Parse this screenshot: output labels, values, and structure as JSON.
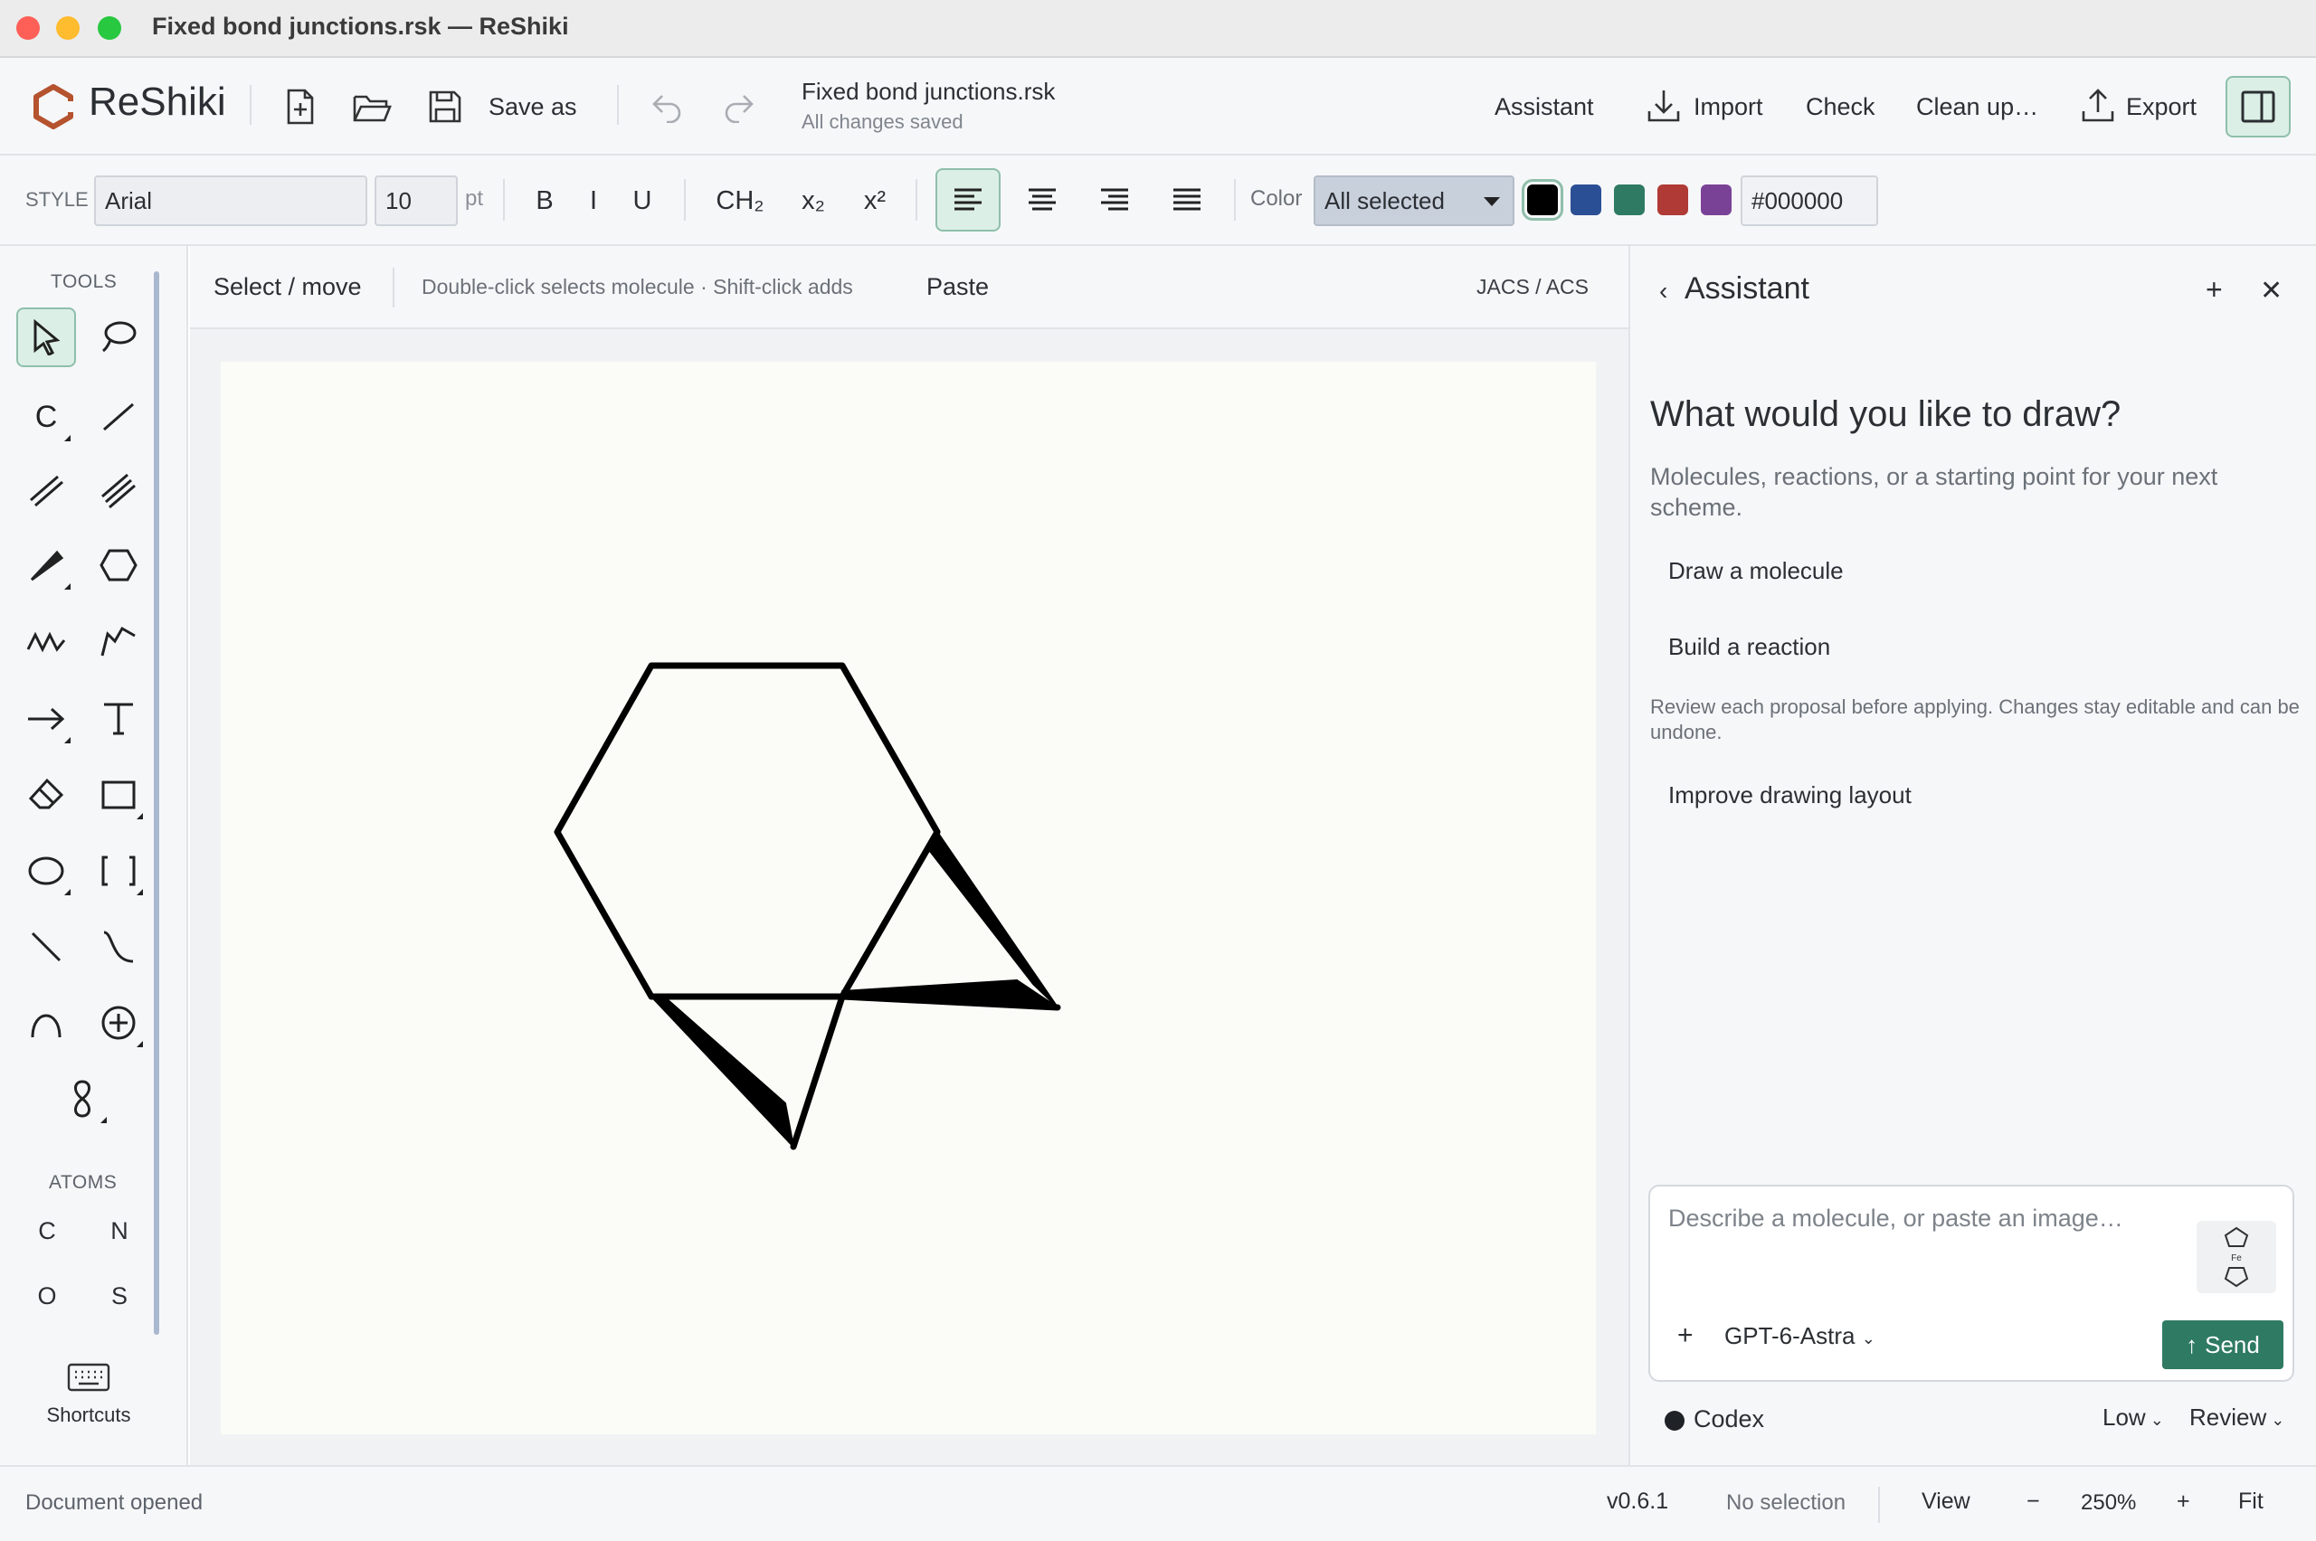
{
  "window": {
    "title": "Fixed bond junctions.rsk — ReShiki",
    "traffic_light_colors": [
      "#fe5f57",
      "#febc2e",
      "#28c840"
    ]
  },
  "app": {
    "name": "ReShiki",
    "brand_color": "#b5532f",
    "accent_color": "#2f7a62"
  },
  "toolbar": {
    "save_as_label": "Save as",
    "file_name": "Fixed bond junctions.rsk",
    "save_status": "All changes saved",
    "assistant_label": "Assistant",
    "import_label": "Import",
    "check_label": "Check",
    "cleanup_label": "Clean up…",
    "export_label": "Export",
    "icons": [
      "new-file-icon",
      "open-folder-icon",
      "save-icon",
      "undo-icon",
      "redo-icon",
      "import-icon",
      "export-icon",
      "panel-toggle-icon"
    ]
  },
  "format": {
    "style_label": "STYLE",
    "font_value": "Arial",
    "size_value": "10",
    "size_unit": "pt",
    "bold": "B",
    "italic": "I",
    "underline": "U",
    "ch2": "CH₂",
    "subscript": "x₂",
    "superscript": "x²",
    "active_alignment": "left",
    "color_label": "Color",
    "color_select_value": "All selected",
    "swatches": [
      "#000000",
      "#2a4f94",
      "#2f7a62",
      "#b03a36",
      "#7a4296"
    ],
    "selected_swatch": "#000000",
    "hex_value": "#000000"
  },
  "tools": {
    "section_label": "TOOLS",
    "items": [
      "select-arrow",
      "lasso",
      "carbon-chain",
      "single-bond",
      "double-bond",
      "triple-bond",
      "wedge-bond",
      "hexagon-ring",
      "zigzag-chain",
      "freehand-chain",
      "arrow",
      "text",
      "eraser",
      "rectangle",
      "ellipse",
      "brackets",
      "line",
      "curve",
      "arc",
      "charge-plus",
      "orbital"
    ],
    "chain_label": "C",
    "atoms_label": "ATOMS",
    "atoms": [
      "C",
      "N",
      "O",
      "S"
    ],
    "shortcuts_label": "Shortcuts"
  },
  "canvas": {
    "mode_label": "Select / move",
    "hint": "Double-click selects molecule · Shift-click adds",
    "paste_label": "Paste",
    "style_preset": "JACS / ACS"
  },
  "assistant": {
    "title": "Assistant",
    "heading": "What would you like to draw?",
    "subheading": "Molecules, reactions, or a starting point for your next scheme.",
    "suggestions": [
      "Draw a molecule",
      "Build a reaction"
    ],
    "disclaimer": "Review each proposal before applying. Changes stay editable and can be undone.",
    "extra_suggestion": "Improve drawing layout",
    "input_placeholder": "Describe a molecule, or paste an image…",
    "model_label": "GPT-6-Astra",
    "send_label": "Send",
    "agent_label": "Codex",
    "effort_label": "Low",
    "mode_label": "Review"
  },
  "status": {
    "message": "Document opened",
    "version": "v0.6.1",
    "selection": "No selection",
    "view_label": "View",
    "zoom_out": "−",
    "zoom_value": "250%",
    "zoom_in": "+",
    "fit_label": "Fit"
  }
}
